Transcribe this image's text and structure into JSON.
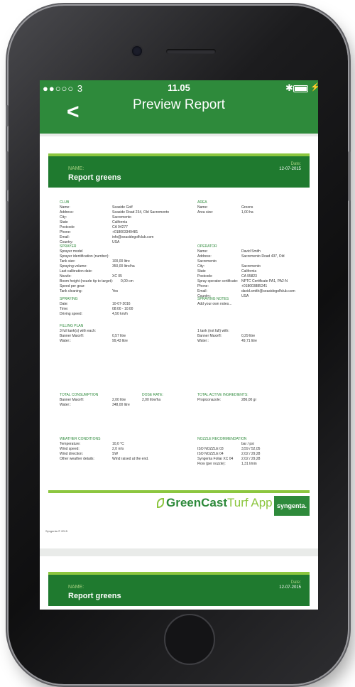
{
  "status": {
    "signal": "●●○○○ 3",
    "time": "11.05",
    "bluetooth": "✱",
    "charge": "⚡"
  },
  "nav": {
    "back": "<",
    "title": "Preview Report"
  },
  "report": {
    "name_label": "NAME:",
    "name": "Report greens",
    "date_label": "Date:",
    "date": "12-07-2015",
    "club": {
      "heading": "CLUB",
      "rows": [
        [
          "Name:",
          "Seaside Golf"
        ],
        [
          "Address:",
          "Seaside Road 234, Old Sacremento"
        ],
        [
          "City:",
          "Sacremento"
        ],
        [
          "State",
          "California"
        ],
        [
          "Postcode",
          "CA 94277"
        ],
        [
          "Phone:",
          "+018003349481"
        ],
        [
          "Email:",
          "info@seasidegolfclub.com"
        ],
        [
          "Country:",
          "USA"
        ]
      ]
    },
    "area": {
      "heading": "AREA",
      "rows": [
        [
          "Name:",
          "Greens"
        ],
        [
          "Area size:",
          "1,00 ha"
        ]
      ]
    },
    "sprayer": {
      "heading": "SPRAYER",
      "rows": [
        [
          "Sprayer model",
          ""
        ],
        [
          "Sprayer identification (number):",
          ""
        ],
        [
          "Tank size:",
          "100,00 litre"
        ],
        [
          "Spraying volume:",
          "350,00 litre/ha"
        ],
        [
          "Last calibration date:",
          ""
        ],
        [
          "Nozzle:",
          "XC 05"
        ],
        [
          "Boom height (nozzle tip to target):",
          "0,00 cm"
        ],
        [
          "Speed per gear:",
          ""
        ],
        [
          "Tank cleaning:",
          "Yes"
        ]
      ]
    },
    "operator": {
      "heading": "OPERATOR",
      "rows": [
        [
          "Name:",
          "David Smith"
        ],
        [
          "Address:",
          "Sacremento Road 437, Old"
        ],
        [
          "",
          "Sacremento"
        ],
        [
          "City:",
          "Sacremento"
        ],
        [
          "State",
          "California"
        ],
        [
          "Postcode",
          "CA 95823"
        ],
        [
          "Spray operator certificate:",
          "NPTC Certificate PA1, PA2-N"
        ],
        [
          "Phone:",
          "+018003885241"
        ],
        [
          "Email:",
          "david.smith@seasidegolfclub.com"
        ],
        [
          "Country:",
          "USA"
        ]
      ]
    },
    "spraying": {
      "heading": "SPRAYING",
      "rows": [
        [
          "Date:",
          "10-07-2016"
        ],
        [
          "Time:",
          "08:00 - 10:00"
        ],
        [
          "Driving speed:",
          "4,50 km/h"
        ]
      ]
    },
    "notes": {
      "heading": "SPRAYING NOTES",
      "text": "Add your own notes..."
    },
    "filling": {
      "heading": "FILLING PLAN",
      "sub": "3 full tank(s) with each:",
      "rows": [
        [
          "Banner Maxx®:",
          "0,57 litre"
        ],
        [
          "Water::",
          "99,43 litre"
        ]
      ]
    },
    "filling2": {
      "sub": "1 tank (not full) with:",
      "rows": [
        [
          "Banner Maxx®:",
          "0,29 litre"
        ],
        [
          "Water::",
          "49,71 litre"
        ]
      ]
    },
    "consumption": {
      "heading": "TOTAL CONSUMPTION",
      "dose_heading": "DOSE RATE:",
      "rows": [
        [
          "Banner Maxx®:",
          "2,00 litre",
          "2,00  litre/ha"
        ],
        [
          "Water::",
          "348,00 litre",
          ""
        ]
      ]
    },
    "active": {
      "heading": "TOTAL ACTIVE INGREDIENTS:",
      "rows": [
        [
          "Propiconazole:",
          "286,00 gr"
        ]
      ]
    },
    "weather": {
      "heading": "WEATHER CONDITIONS",
      "rows": [
        [
          "Temperature:",
          "10,0 °C"
        ],
        [
          "Wind speed:",
          "2,0 m/s"
        ],
        [
          "Wind direction:",
          "SW"
        ],
        [
          "Other weather details:",
          "Wind raised at the end."
        ]
      ]
    },
    "nozzle": {
      "heading": "NOZZLE RECOMMENDATION",
      "rows": [
        [
          "",
          "bar / psi"
        ],
        [
          "ISO NOZZLE 03",
          "3,59 / 52,05"
        ],
        [
          "ISO NOZZLE 04",
          "2,02 / 29,28"
        ],
        [
          "Syngenta Foliar XC 04",
          "2,02 / 29,28"
        ],
        [
          "Flow (per nozzle):",
          "1,31 l/min"
        ]
      ]
    },
    "logo_greencast": "GreenCast",
    "logo_turf": "Turf App",
    "logo_syngenta": "syngenta.",
    "copyright": "Syngenta © 2015"
  },
  "report2": {
    "name_label": "NAME:",
    "name": "Report greens",
    "date_label": "Date:",
    "date": "12-07-2015"
  }
}
